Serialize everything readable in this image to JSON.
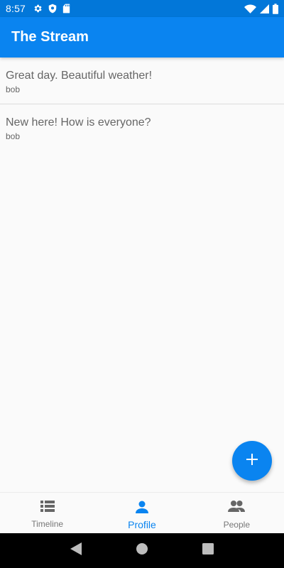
{
  "status_bar": {
    "time": "8:57",
    "left_icons": [
      "gear-icon",
      "shield-icon",
      "sd-card-icon"
    ],
    "right_icons": [
      "wifi-icon",
      "signal-icon",
      "battery-icon"
    ]
  },
  "app_bar": {
    "title": "The Stream"
  },
  "feed": {
    "items": [
      {
        "text": "Great day. Beautiful weather!",
        "author": "bob"
      },
      {
        "text": "New here! How is everyone?",
        "author": "bob"
      }
    ]
  },
  "fab": {
    "icon": "plus-icon"
  },
  "bottom_nav": {
    "items": [
      {
        "label": "Timeline",
        "icon": "list-icon",
        "active": false
      },
      {
        "label": "Profile",
        "icon": "person-icon",
        "active": true
      },
      {
        "label": "People",
        "icon": "people-icon",
        "active": false
      }
    ]
  },
  "system_nav": {
    "icons": [
      "back-icon",
      "home-icon",
      "recents-icon"
    ]
  },
  "colors": {
    "primary": "#0a84f0",
    "status_bar": "#0277d9",
    "text_secondary": "#666666",
    "nav_inactive": "#777777",
    "background": "#fafafa"
  }
}
